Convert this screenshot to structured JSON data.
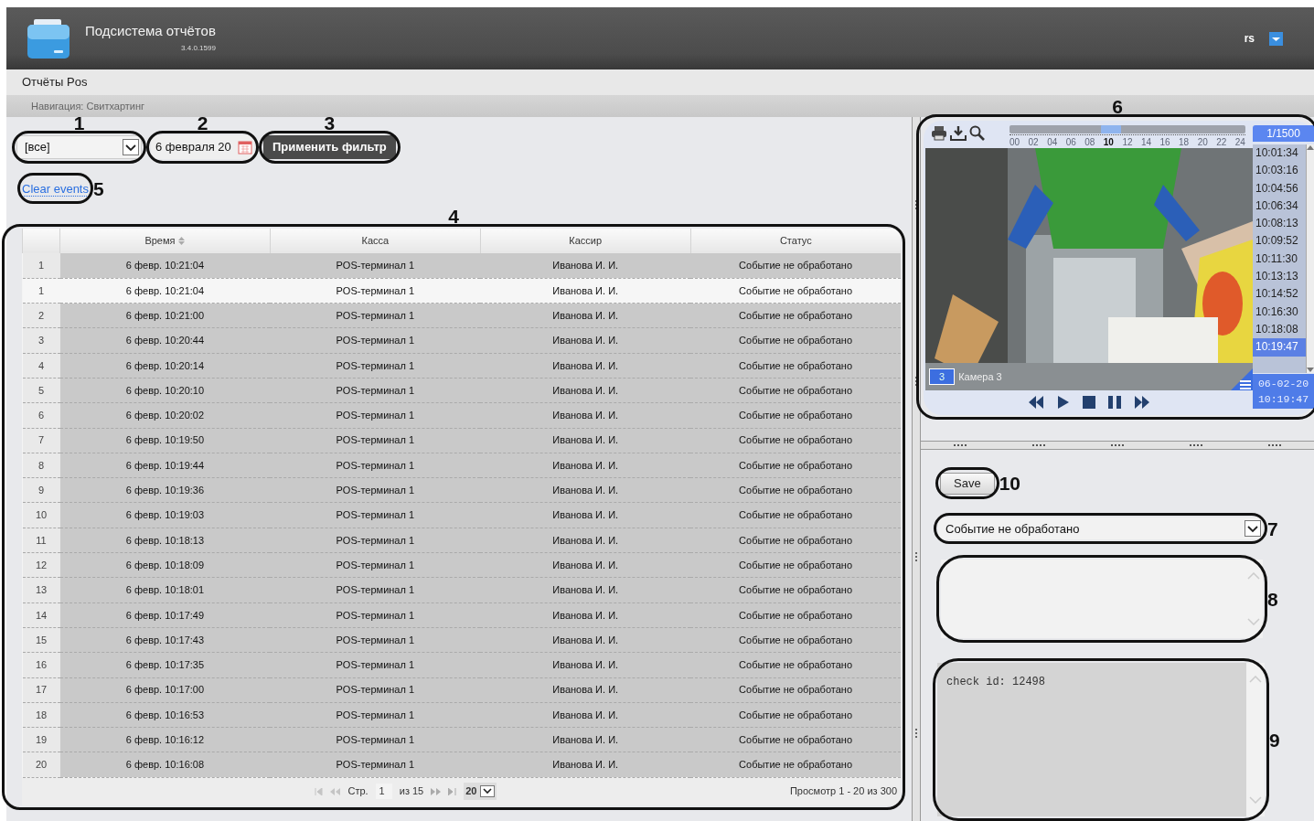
{
  "header": {
    "title": "Подсистема отчётов",
    "version": "3.4.0.1599",
    "user": "rs"
  },
  "menu": [
    {
      "label": "Отчёты Pos"
    }
  ],
  "breadcrumb": "Навигация: Свитхартинг",
  "filter": {
    "device": {
      "value": "[все]",
      "callout": "1"
    },
    "date": {
      "value": "6 февраля 20",
      "callout": "2"
    },
    "apply": {
      "label": "Применить фильтр",
      "callout": "3"
    },
    "clear": {
      "label": "Clear events",
      "callout": "5"
    }
  },
  "table": {
    "callout": "4",
    "columns": [
      {
        "label": "Время",
        "sortable": true
      },
      {
        "label": "Касса",
        "sortable": false
      },
      {
        "label": "Кассир",
        "sortable": false
      },
      {
        "label": "Статус",
        "sortable": false
      }
    ],
    "rows": [
      {
        "index": "1",
        "time": "6 февр. 10:21:04",
        "register": "POS-терминал 1",
        "cashier": "Иванова И. И.",
        "status": "Событие не обработано",
        "selected": false
      },
      {
        "index": "1",
        "time": "6 февр. 10:21:04",
        "register": "POS-терминал 1",
        "cashier": "Иванова И. И.",
        "status": "Событие не обработано",
        "selected": true
      },
      {
        "index": "2",
        "time": "6 февр. 10:21:00",
        "register": "POS-терминал 1",
        "cashier": "Иванова И. И.",
        "status": "Событие не обработано",
        "selected": false
      },
      {
        "index": "3",
        "time": "6 февр. 10:20:44",
        "register": "POS-терминал 1",
        "cashier": "Иванова И. И.",
        "status": "Событие не обработано",
        "selected": false
      },
      {
        "index": "4",
        "time": "6 февр. 10:20:14",
        "register": "POS-терминал 1",
        "cashier": "Иванова И. И.",
        "status": "Событие не обработано",
        "selected": false
      },
      {
        "index": "5",
        "time": "6 февр. 10:20:10",
        "register": "POS-терминал 1",
        "cashier": "Иванова И. И.",
        "status": "Событие не обработано",
        "selected": false
      },
      {
        "index": "6",
        "time": "6 февр. 10:20:02",
        "register": "POS-терминал 1",
        "cashier": "Иванова И. И.",
        "status": "Событие не обработано",
        "selected": false
      },
      {
        "index": "7",
        "time": "6 февр. 10:19:50",
        "register": "POS-терминал 1",
        "cashier": "Иванова И. И.",
        "status": "Событие не обработано",
        "selected": false
      },
      {
        "index": "8",
        "time": "6 февр. 10:19:44",
        "register": "POS-терминал 1",
        "cashier": "Иванова И. И.",
        "status": "Событие не обработано",
        "selected": false
      },
      {
        "index": "9",
        "time": "6 февр. 10:19:36",
        "register": "POS-терминал 1",
        "cashier": "Иванова И. И.",
        "status": "Событие не обработано",
        "selected": false
      },
      {
        "index": "10",
        "time": "6 февр. 10:19:03",
        "register": "POS-терминал 1",
        "cashier": "Иванова И. И.",
        "status": "Событие не обработано",
        "selected": false
      },
      {
        "index": "11",
        "time": "6 февр. 10:18:13",
        "register": "POS-терминал 1",
        "cashier": "Иванова И. И.",
        "status": "Событие не обработано",
        "selected": false
      },
      {
        "index": "12",
        "time": "6 февр. 10:18:09",
        "register": "POS-терминал 1",
        "cashier": "Иванова И. И.",
        "status": "Событие не обработано",
        "selected": false
      },
      {
        "index": "13",
        "time": "6 февр. 10:18:01",
        "register": "POS-терминал 1",
        "cashier": "Иванова И. И.",
        "status": "Событие не обработано",
        "selected": false
      },
      {
        "index": "14",
        "time": "6 февр. 10:17:49",
        "register": "POS-терминал 1",
        "cashier": "Иванова И. И.",
        "status": "Событие не обработано",
        "selected": false
      },
      {
        "index": "15",
        "time": "6 февр. 10:17:43",
        "register": "POS-терминал 1",
        "cashier": "Иванова И. И.",
        "status": "Событие не обработано",
        "selected": false
      },
      {
        "index": "16",
        "time": "6 февр. 10:17:35",
        "register": "POS-терминал 1",
        "cashier": "Иванова И. И.",
        "status": "Событие не обработано",
        "selected": false
      },
      {
        "index": "17",
        "time": "6 февр. 10:17:00",
        "register": "POS-терминал 1",
        "cashier": "Иванова И. И.",
        "status": "Событие не обработано",
        "selected": false
      },
      {
        "index": "18",
        "time": "6 февр. 10:16:53",
        "register": "POS-терминал 1",
        "cashier": "Иванова И. И.",
        "status": "Событие не обработано",
        "selected": false
      },
      {
        "index": "19",
        "time": "6 февр. 10:16:12",
        "register": "POS-терминал 1",
        "cashier": "Иванова И. И.",
        "status": "Событие не обработано",
        "selected": false
      },
      {
        "index": "20",
        "time": "6 февр. 10:16:08",
        "register": "POS-терминал 1",
        "cashier": "Иванова И. И.",
        "status": "Событие не обработано",
        "selected": false
      }
    ],
    "pager": {
      "page_label": "Стр.",
      "page": "1",
      "of": "из 15",
      "page_size": "20",
      "summary": "Просмотр 1 - 20 из 300"
    }
  },
  "video": {
    "callout": "6",
    "counter": "1/1500",
    "timeline": {
      "level": 0.43,
      "labels": [
        {
          "text": "00",
          "selected": false
        },
        {
          "text": "02",
          "selected": false
        },
        {
          "text": "04",
          "selected": false
        },
        {
          "text": "06",
          "selected": false
        },
        {
          "text": "08",
          "selected": false
        },
        {
          "text": "10",
          "selected": true
        },
        {
          "text": "12",
          "selected": false
        },
        {
          "text": "14",
          "selected": false
        },
        {
          "text": "16",
          "selected": false
        },
        {
          "text": "18",
          "selected": false
        },
        {
          "text": "20",
          "selected": false
        },
        {
          "text": "22",
          "selected": false
        },
        {
          "text": "24",
          "selected": false
        }
      ]
    },
    "times": [
      {
        "label": "10:01:34",
        "selected": false
      },
      {
        "label": "10:03:16",
        "selected": false
      },
      {
        "label": "10:04:56",
        "selected": false
      },
      {
        "label": "10:06:34",
        "selected": false
      },
      {
        "label": "10:08:13",
        "selected": false
      },
      {
        "label": "10:09:52",
        "selected": false
      },
      {
        "label": "10:11:30",
        "selected": false
      },
      {
        "label": "10:13:13",
        "selected": false
      },
      {
        "label": "10:14:52",
        "selected": false
      },
      {
        "label": "10:16:30",
        "selected": false
      },
      {
        "label": "10:18:08",
        "selected": false
      },
      {
        "label": "10:19:47",
        "selected": true
      }
    ],
    "camera_number": "3",
    "camera_name": "Камера 3",
    "date": "06-02-20",
    "time": "10:19:47"
  },
  "event": {
    "save": {
      "label": "Save",
      "callout": "10"
    },
    "status": {
      "value": "Событие не обработано",
      "callout": "7"
    },
    "comment": {
      "callout": "8"
    },
    "details": {
      "value": "check id: 12498",
      "callout": "9"
    }
  }
}
